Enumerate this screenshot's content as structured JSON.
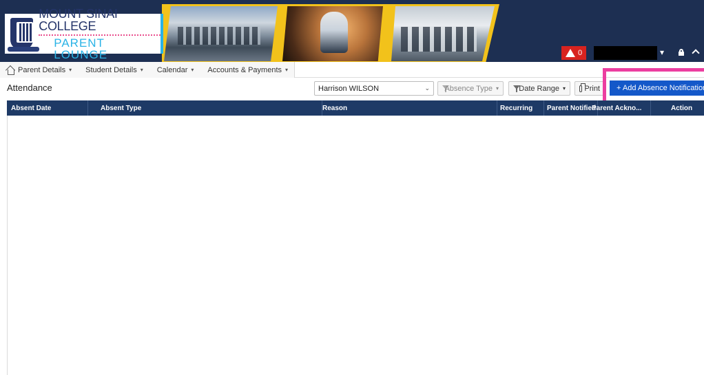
{
  "branding": {
    "college_name": "MOUNT SINAI COLLEGE",
    "portal_name": "PARENT LOUNGE"
  },
  "header": {
    "alert_count": "0",
    "user_caret": "▾"
  },
  "nav": {
    "items": [
      {
        "label": "Parent Details"
      },
      {
        "label": "Student Details"
      },
      {
        "label": "Calendar"
      },
      {
        "label": "Accounts & Payments"
      }
    ]
  },
  "toolbar": {
    "page_title": "Attendance",
    "student_selected": "Harrison WILSON",
    "absence_type_label": "Absence Type",
    "date_range_label": "Date Range",
    "print_label": "Print",
    "add_absence_label": "+ Add Absence Notification"
  },
  "table": {
    "columns": [
      "Absent Date",
      "Absent Type",
      "Reason",
      "Recurring",
      "Parent Notified",
      "Parent Ackno...",
      "Action"
    ],
    "rows": []
  },
  "colors": {
    "banner_bg": "#1d2f52",
    "accent_yellow": "#f2c21b",
    "header_row_bg": "#1e3a66",
    "primary_button": "#1458c9",
    "highlight": "#ec3ea0",
    "alert_red": "#d8231f"
  }
}
